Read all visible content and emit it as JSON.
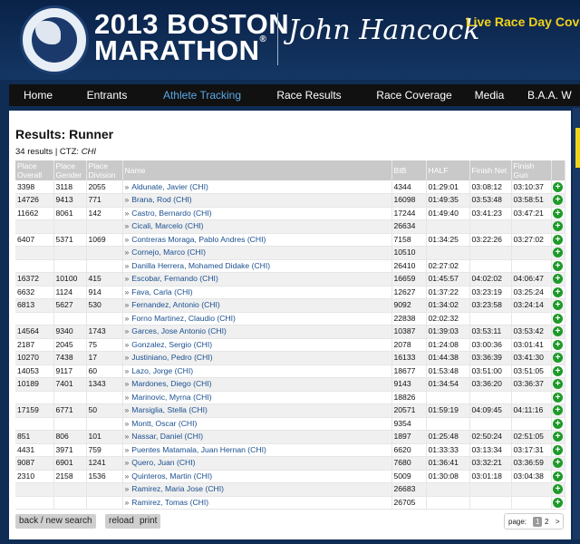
{
  "header": {
    "logo_alt": "Boston Athletic Association",
    "title_line1": "2013 BOSTON",
    "title_line2": "MARATHON",
    "registered_mark": "®",
    "sponsor": "John Hancock",
    "live_text": "Live Race Day Cove"
  },
  "nav": {
    "items": [
      {
        "label": "Home",
        "active": false
      },
      {
        "label": "Entrants",
        "active": false
      },
      {
        "label": "Athlete Tracking",
        "active": true
      },
      {
        "label": "Race Results",
        "active": false
      },
      {
        "label": "Race Coverage",
        "active": false
      },
      {
        "label": "Media",
        "active": false
      },
      {
        "label": "B.A.A. W",
        "active": false
      }
    ]
  },
  "results": {
    "title": "Results: Runner",
    "count_text": "34 results | CTZ: ",
    "country": "CHI",
    "columns": [
      "Place Overall",
      "Place Gender",
      "Place Division",
      "Name",
      "BIB",
      "HALF",
      "Finish Net",
      "Finish Gun",
      ""
    ],
    "rows": [
      [
        "3398",
        "3118",
        "2055",
        "Aldunate, Javier (CHI)",
        "4344",
        "01:29:01",
        "03:08:12",
        "03:10:37"
      ],
      [
        "14726",
        "9413",
        "771",
        "Brana, Rod (CHI)",
        "16098",
        "01:49:35",
        "03:53:48",
        "03:58:51"
      ],
      [
        "11662",
        "8061",
        "142",
        "Castro, Bernardo (CHI)",
        "17244",
        "01:49:40",
        "03:41:23",
        "03:47:21"
      ],
      [
        "",
        "",
        "",
        "Cicali, Marcelo (CHI)",
        "26634",
        "",
        "",
        ""
      ],
      [
        "6407",
        "5371",
        "1069",
        "Contreras Moraga, Pablo Andres (CHI)",
        "7158",
        "01:34:25",
        "03:22:26",
        "03:27:02"
      ],
      [
        "",
        "",
        "",
        "Cornejo, Marco (CHI)",
        "10510",
        "",
        "",
        ""
      ],
      [
        "",
        "",
        "",
        "Danilla Herrera, Mohamed Didake (CHI)",
        "26410",
        "02:27:02",
        "",
        ""
      ],
      [
        "16372",
        "10100",
        "415",
        "Escobar, Fernando (CHI)",
        "16659",
        "01:45:57",
        "04:02:02",
        "04:06:47"
      ],
      [
        "6632",
        "1124",
        "914",
        "Fava, Carla (CHI)",
        "12627",
        "01:37:22",
        "03:23:19",
        "03:25:24"
      ],
      [
        "6813",
        "5627",
        "530",
        "Fernandez, Antonio (CHI)",
        "9092",
        "01:34:02",
        "03:23:58",
        "03:24:14"
      ],
      [
        "",
        "",
        "",
        "Forno Martinez, Claudio (CHI)",
        "22838",
        "02:02:32",
        "",
        ""
      ],
      [
        "14564",
        "9340",
        "1743",
        "Garces, Jose Antonio (CHI)",
        "10387",
        "01:39:03",
        "03:53:11",
        "03:53:42"
      ],
      [
        "2187",
        "2045",
        "75",
        "Gonzalez, Sergio (CHI)",
        "2078",
        "01:24:08",
        "03:00:36",
        "03:01:41"
      ],
      [
        "10270",
        "7438",
        "17",
        "Justiniano, Pedro (CHI)",
        "16133",
        "01:44:38",
        "03:36:39",
        "03:41:30"
      ],
      [
        "14053",
        "9117",
        "60",
        "Lazo, Jorge (CHI)",
        "18677",
        "01:53:48",
        "03:51:00",
        "03:51:05"
      ],
      [
        "10189",
        "7401",
        "1343",
        "Mardones, Diego (CHI)",
        "9143",
        "01:34:54",
        "03:36:20",
        "03:36:37"
      ],
      [
        "",
        "",
        "",
        "Marinovic, Myrna (CHI)",
        "18826",
        "",
        "",
        ""
      ],
      [
        "17159",
        "6771",
        "50",
        "Marsiglia, Stella (CHI)",
        "20571",
        "01:59:19",
        "04:09:45",
        "04:11:16"
      ],
      [
        "",
        "",
        "",
        "Montt, Oscar (CHI)",
        "9354",
        "",
        "",
        ""
      ],
      [
        "851",
        "806",
        "101",
        "Nassar, Daniel (CHI)",
        "1897",
        "01:25:48",
        "02:50:24",
        "02:51:05"
      ],
      [
        "4431",
        "3971",
        "759",
        "Puentes Matamala, Juan Hernan (CHI)",
        "6620",
        "01:33:33",
        "03:13:34",
        "03:17:31"
      ],
      [
        "9087",
        "6901",
        "1241",
        "Quero, Juan (CHI)",
        "7680",
        "01:36:41",
        "03:32:21",
        "03:36:59"
      ],
      [
        "2310",
        "2158",
        "1536",
        "Quinteros, Martin (CHI)",
        "5009",
        "01:30:08",
        "03:01:18",
        "03:04:38"
      ],
      [
        "",
        "",
        "",
        "Ramirez, Maria Jose (CHI)",
        "26683",
        "",
        "",
        ""
      ],
      [
        "",
        "",
        "",
        "Ramirez, Tomas (CHI)",
        "26705",
        "",
        "",
        ""
      ]
    ]
  },
  "buttons": {
    "back": "back / new search",
    "reload": "reload",
    "print": "print"
  },
  "pager": {
    "label": "page:",
    "current": "1",
    "next_page": "2",
    "next_arrow": ">"
  },
  "colors": {
    "header_bg": "#0f2c54",
    "nav_active": "#5aa8e6",
    "live_text": "#f2d21a",
    "link": "#1a4f8f",
    "add_button": "#1f9a2a"
  }
}
